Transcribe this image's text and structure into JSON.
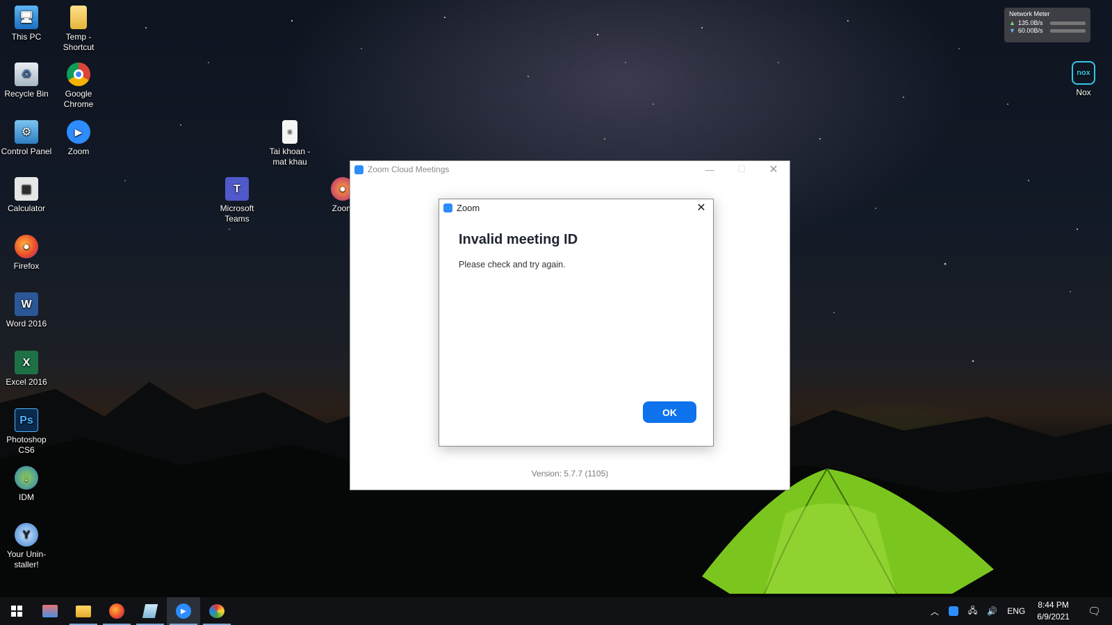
{
  "desktop": {
    "icons_col1": [
      {
        "label": "This PC",
        "icon": "computer-icon"
      },
      {
        "label": "Recycle Bin",
        "icon": "recycle-bin-icon"
      },
      {
        "label": "Control Panel",
        "icon": "control-panel-icon"
      },
      {
        "label": "Calculator",
        "icon": "calculator-icon"
      },
      {
        "label": "Firefox",
        "icon": "firefox-icon"
      },
      {
        "label": "Word 2016",
        "icon": "word-icon"
      },
      {
        "label": "Excel 2016",
        "icon": "excel-icon"
      },
      {
        "label": "Photoshop CS6",
        "icon": "photoshop-icon"
      },
      {
        "label": "IDM",
        "icon": "idm-icon"
      },
      {
        "label": "Your Unin-staller!",
        "icon": "uninstaller-icon"
      }
    ],
    "icons_col2": [
      {
        "label": "Temp - Shortcut",
        "icon": "folder-icon"
      },
      {
        "label": "Google Chrome",
        "icon": "chrome-icon"
      },
      {
        "label": "Zoom",
        "icon": "zoom-icon"
      }
    ],
    "icon_teams": {
      "label": "Microsoft Teams",
      "icon": "teams-icon"
    },
    "icon_taikhoan": {
      "label": "Tai khoan - mat khau",
      "icon": "text-file-icon"
    },
    "icon_zoom2": {
      "label": "Zoom",
      "icon": "zoom-firefox-icon"
    },
    "icon_nox": {
      "label": "Nox",
      "icon": "nox-icon"
    }
  },
  "network_meter": {
    "title": "Network Meter",
    "upload": "135.0B/s",
    "download": "60.00B/s"
  },
  "zoom_window": {
    "title": "Zoom Cloud Meetings",
    "version": "Version: 5.7.7 (1105)"
  },
  "dialog": {
    "title": "Zoom",
    "heading": "Invalid meeting ID",
    "message": "Please check and try again.",
    "ok_label": "OK"
  },
  "taskbar": {
    "language": "ENG",
    "time": "8:44 PM",
    "date": "6/9/2021"
  },
  "colors": {
    "zoom_blue": "#0e72ed",
    "taskbar_bg": "#101215"
  }
}
